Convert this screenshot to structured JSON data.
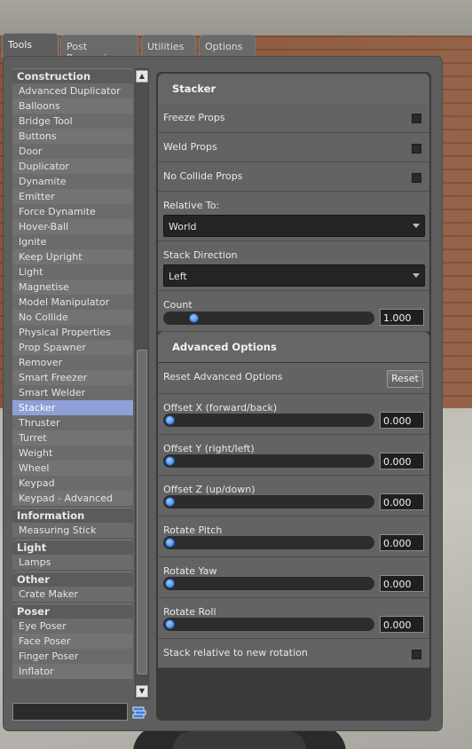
{
  "tabs": [
    "Tools",
    "Post Processing",
    "Utilities",
    "Options"
  ],
  "categories": [
    {
      "name": "Construction",
      "items": [
        "Advanced Duplicator",
        "Balloons",
        "Bridge Tool",
        "Buttons",
        "Door",
        "Duplicator",
        "Dynamite",
        "Emitter",
        "Force Dynamite",
        "Hover-Ball",
        "Ignite",
        "Keep Upright",
        "Light",
        "Magnetise",
        "Model Manipulator",
        "No Collide",
        "Physical Properties",
        "Prop Spawner",
        "Remover",
        "Smart Freezer",
        "Smart Welder",
        "Stacker",
        "Thruster",
        "Turret",
        "Weight",
        "Wheel",
        "Keypad",
        "Keypad - Advanced"
      ]
    },
    {
      "name": "Information",
      "items": [
        "Measuring Stick"
      ]
    },
    {
      "name": "Light",
      "items": [
        "Lamps"
      ]
    },
    {
      "name": "Other",
      "items": [
        "Crate Maker"
      ]
    },
    {
      "name": "Poser",
      "items": [
        "Eye Poser",
        "Face Poser",
        "Finger Poser",
        "Inflator"
      ]
    }
  ],
  "selected_tool": "Stacker",
  "search": {
    "value": ""
  },
  "stacker": {
    "title": "Stacker",
    "freeze_props": "Freeze Props",
    "weld_props": "Weld Props",
    "no_collide_props": "No Collide Props",
    "relative_to_label": "Relative To:",
    "relative_to_value": "World",
    "stack_direction_label": "Stack Direction",
    "stack_direction_value": "Left",
    "count_label": "Count",
    "count_value": "1.000",
    "count_fraction": 0.12
  },
  "advanced": {
    "title": "Advanced Options",
    "reset_label": "Reset Advanced Options",
    "reset_button": "Reset",
    "offset_x_label": "Offset X (forward/back)",
    "offset_x_value": "0.000",
    "offset_y_label": "Offset Y (right/left)",
    "offset_y_value": "0.000",
    "offset_z_label": "Offset Z (up/down)",
    "offset_z_value": "0.000",
    "rotate_pitch_label": "Rotate Pitch",
    "rotate_pitch_value": "0.000",
    "rotate_yaw_label": "Rotate Yaw",
    "rotate_yaw_value": "0.000",
    "rotate_roll_label": "Rotate Roll",
    "rotate_roll_value": "0.000",
    "stack_relative_label": "Stack relative to new rotation"
  },
  "colors": {
    "selection": "#8ea0d6",
    "slider_knob": "#2a78d6"
  }
}
